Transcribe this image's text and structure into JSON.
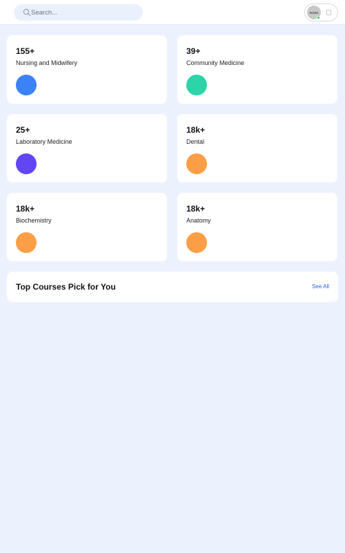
{
  "search": {
    "placeholder": "Search..."
  },
  "profile": {
    "avatar_text": "50x50",
    "online": true
  },
  "colors": {
    "blue": "#3b82f6",
    "teal": "#2dd4a7",
    "violet": "#6245f5",
    "orange": "#fb9e45",
    "link": "#2563eb"
  },
  "stats": [
    {
      "count": "155+",
      "label": "Nursing and Midwifery",
      "color": "#3b82f6"
    },
    {
      "count": "39+",
      "label": "Community Medicine",
      "color": "#2dd4a7"
    },
    {
      "count": "25+",
      "label": "Laboratory Medicine",
      "color": "#6245f5"
    },
    {
      "count": "18k+",
      "label": "Dental",
      "color": "#fb9e45"
    },
    {
      "count": "18k+",
      "label": "Biochemistry",
      "color": "#fb9e45"
    },
    {
      "count": "18k+",
      "label": "Anatomy",
      "color": "#fb9e45"
    }
  ],
  "courses_section": {
    "title": "Top Courses Pick for You",
    "see_all": "See All"
  }
}
